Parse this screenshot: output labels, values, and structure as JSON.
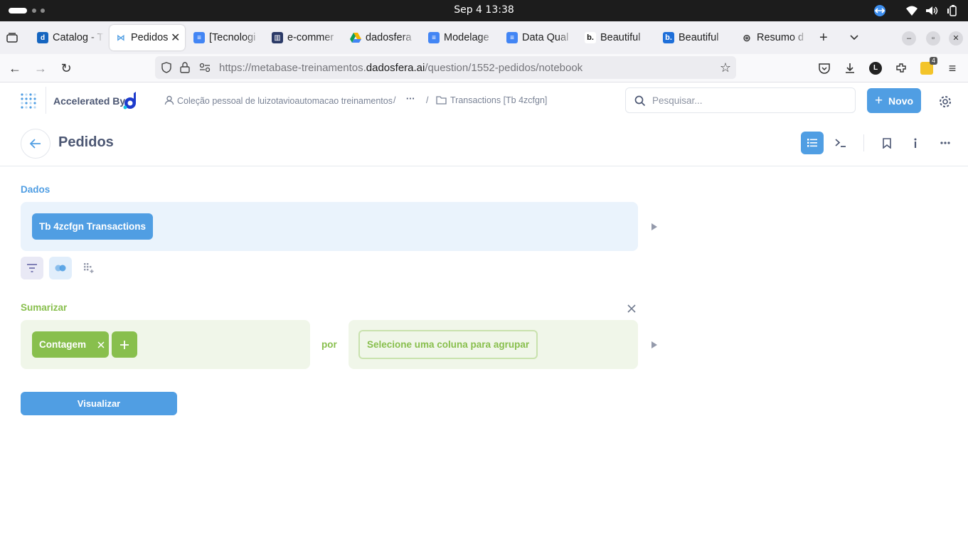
{
  "os": {
    "clock": "Sep 4  13:38"
  },
  "browser": {
    "tabs": [
      {
        "title": "Catalog - T",
        "favicon_color": "#1565c0",
        "favicon_letter": "d"
      },
      {
        "title": "Pedidos",
        "favicon_color": "#509ee3",
        "favicon_letter": "M",
        "active": true
      },
      {
        "title": "[Tecnologi",
        "favicon_color": "#4285f4",
        "favicon_letter": "≡"
      },
      {
        "title": "e-commer",
        "favicon_color": "#2b3a67",
        "favicon_letter": "▦"
      },
      {
        "title": "dadosfera",
        "favicon_color": "#f4b400",
        "favicon_letter": "▲"
      },
      {
        "title": "Modelage",
        "favicon_color": "#4285f4",
        "favicon_letter": "≡"
      },
      {
        "title": "Data Qual",
        "favicon_color": "#4285f4",
        "favicon_letter": "≡"
      },
      {
        "title": "Beautiful",
        "favicon_color": "#ffffff",
        "favicon_letter": "b."
      },
      {
        "title": "Beautiful",
        "favicon_color": "#1e6fd9",
        "favicon_letter": "b."
      },
      {
        "title": "Resumo d",
        "favicon_color": "#ffffff",
        "favicon_letter": "⊛"
      }
    ],
    "url_prefix": "https://metabase-treinamentos.",
    "url_domain": "dadosfera.ai",
    "url_path": "/question/1552-pedidos/notebook",
    "extensions_badge": "4"
  },
  "app": {
    "accelerated_by": "Accelerated By",
    "breadcrumb_collection": "Coleção pessoal de luizotavioautomacao treinamentos",
    "breadcrumb_sep": "/",
    "breadcrumb_more": "···",
    "breadcrumb_folder": "Transactions [Tb 4zcfgn]",
    "search_placeholder": "Pesquisar...",
    "new_button": "Novo"
  },
  "question": {
    "title": "Pedidos"
  },
  "notebook": {
    "data_label": "Dados",
    "data_table": "Tb 4zcfgn Transactions",
    "summarize_label": "Sumarizar",
    "metric": "Contagem",
    "by_label": "por",
    "group_placeholder": "Selecione uma coluna para agrupar",
    "visualize_button": "Visualizar"
  },
  "colors": {
    "brand": "#509ee3",
    "summarize": "#88bf4d",
    "text": "#4c5773"
  }
}
